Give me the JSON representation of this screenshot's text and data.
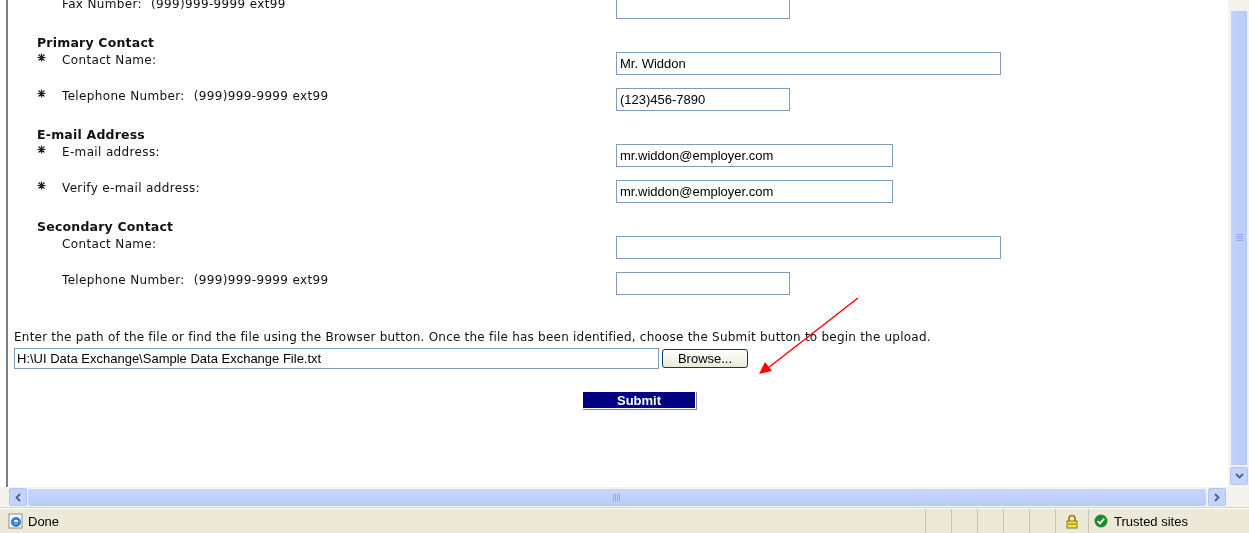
{
  "sections": [
    {
      "fields": [
        {
          "required": false,
          "label": "Fax Number:",
          "hint": "(999)999-9999 ext99",
          "kind": "phone"
        }
      ]
    },
    {
      "heading": "Primary Contact",
      "fields": [
        {
          "required": true,
          "label": "Contact Name:",
          "kind": "name",
          "value": "Mr. Widdon"
        },
        {
          "required": true,
          "label": "Telephone Number:",
          "hint": "(999)999-9999 ext99",
          "kind": "phone",
          "value": "(123)456-7890"
        }
      ]
    },
    {
      "heading": "E-mail Address",
      "fields": [
        {
          "required": true,
          "label": "E-mail address:",
          "kind": "email",
          "value": "mr.widdon@employer.com"
        },
        {
          "required": true,
          "label": "Verify e-mail address:",
          "kind": "email",
          "value": "mr.widdon@employer.com"
        }
      ]
    },
    {
      "heading": "Secondary Contact",
      "fields": [
        {
          "required": false,
          "label": "Contact Name:",
          "kind": "name"
        },
        {
          "required": false,
          "label": "Telephone Number:",
          "hint": "(999)999-9999 ext99",
          "kind": "phone"
        }
      ]
    }
  ],
  "upload": {
    "instructions": "Enter the path of the file or find the file using the Browser button. Once the file has been identified, choose the Submit button to begin the upload.",
    "path": "H:\\UI Data Exchange\\Sample Data Exchange File.txt",
    "browse_button": "Browse...",
    "submit_button": "Submit"
  },
  "status_bar": {
    "text": "Done",
    "zone": "Trusted sites",
    "secure": true
  }
}
